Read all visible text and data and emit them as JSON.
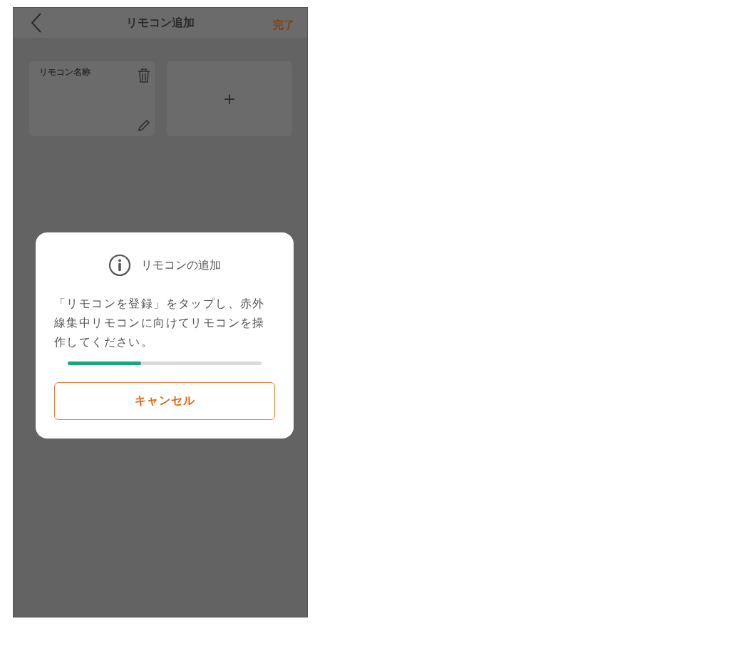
{
  "header": {
    "title": "リモコン追加",
    "done": "完了"
  },
  "remotes": [
    {
      "kind": "remote",
      "name": "リモコン名称"
    },
    {
      "kind": "add",
      "label": "+"
    }
  ],
  "dialog": {
    "title": "リモコンの追加",
    "message": "「リモコンを登録」をタップし、赤外線集中リモコンに向けてリモコンを操作してください。",
    "progress": {
      "level": 0.38
    },
    "cancel": "キャンセル"
  }
}
